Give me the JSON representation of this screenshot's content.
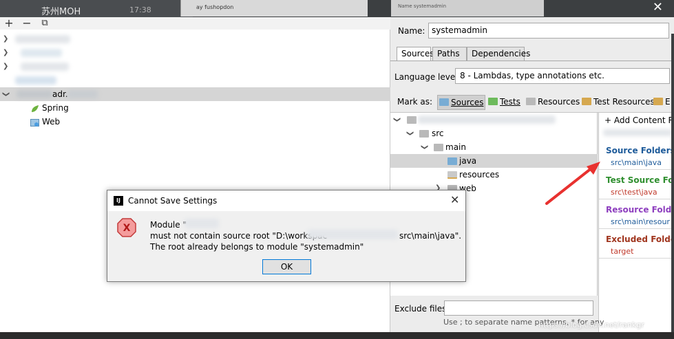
{
  "topbar": {
    "chat_name": "苏州MOH",
    "chat_time": "17:38",
    "mid_text": "ay fushopdon",
    "right_text": "Name  systemadmin",
    "close_glyph": "✕"
  },
  "left_toolbar": {
    "add_glyph": "+",
    "remove_glyph": "−",
    "copy_glyph": "⧉"
  },
  "left_tree": {
    "module_label": "adr.",
    "children": [
      {
        "label": "Spring",
        "icon": "spring-icon"
      },
      {
        "label": "Web",
        "icon": "web-icon"
      }
    ]
  },
  "settings": {
    "name_label": "Name:",
    "name_value": "systemadmin",
    "tabs": [
      "Sources",
      "Paths",
      "Dependencies"
    ],
    "active_tab": "Sources",
    "language_label": "Language level:",
    "language_value": "8 - Lambdas, type annotations etc.",
    "mark_as_label": "Mark as:",
    "mark_buttons": [
      {
        "label": "Sources",
        "color": "#78acd4"
      },
      {
        "label": "Tests",
        "color": "#6dba5c"
      },
      {
        "label": "Resources",
        "color": "#b9b9b9"
      },
      {
        "label": "Test Resources",
        "color": "#d6a84f"
      },
      {
        "label": "E",
        "color": "#d6a84f"
      }
    ],
    "exclude_label": "Exclude files:",
    "exclude_value": "",
    "exclude_hint": "Use ; to separate name patterns, * for any"
  },
  "folder_tree": [
    {
      "label": "src",
      "depth": 1,
      "expanded": true
    },
    {
      "label": "main",
      "depth": 2,
      "expanded": true
    },
    {
      "label": "java",
      "depth": 3,
      "selected": true,
      "source": true
    },
    {
      "label": "resources",
      "depth": 3
    },
    {
      "label": "web",
      "depth": 3,
      "expanded": false
    }
  ],
  "content_roots": {
    "add_label": "+ Add Content R",
    "sections": [
      {
        "title": "Source Folders",
        "path": "src\\main\\java",
        "title_color": "#1e5b9a",
        "path_color": "#1e5b9a"
      },
      {
        "title": "Test Source Fold",
        "path": "src\\test\\java",
        "title_color": "#2f8f2f",
        "path_color": "#c0392b"
      },
      {
        "title": "Resource Folders",
        "path": "src\\main\\resour",
        "title_color": "#8e3fbf",
        "path_color": "#1e5b9a"
      },
      {
        "title": "Excluded Folders",
        "path": "target",
        "title_color": "#a0351e",
        "path_color": "#c0392b"
      }
    ]
  },
  "dialog": {
    "title": "Cannot Save Settings",
    "logo_text": "IJ",
    "close_glyph": "✕",
    "line1": "Module \"",
    "line2a": "must not contain source root \"D:\\workspac",
    "line2b": "src\\main\\java\".",
    "line3": "The root already belongs to module \"systemadmin\"",
    "ok_label": "OK"
  },
  "watermark": "https://blog.csdn.net/rankgr"
}
